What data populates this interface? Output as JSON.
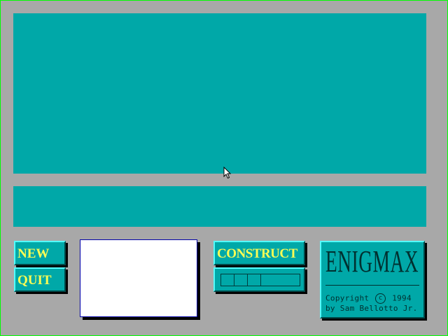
{
  "buttons": {
    "new_label": "NEW",
    "quit_label": "QUIT",
    "construct_label": "CONSTRUCT"
  },
  "logo": {
    "title": "ENIGMAX",
    "copyright_word": "Copyright",
    "copyright_symbol": "c",
    "year": "1994",
    "author": "by Sam Bellotto Jr."
  },
  "colors": {
    "background": "#a8a8a8",
    "panel": "#00a8a8",
    "button_text": "#fcfc54",
    "frame": "#00ff00"
  },
  "icons": {
    "cursor": "mouse-pointer-icon"
  }
}
